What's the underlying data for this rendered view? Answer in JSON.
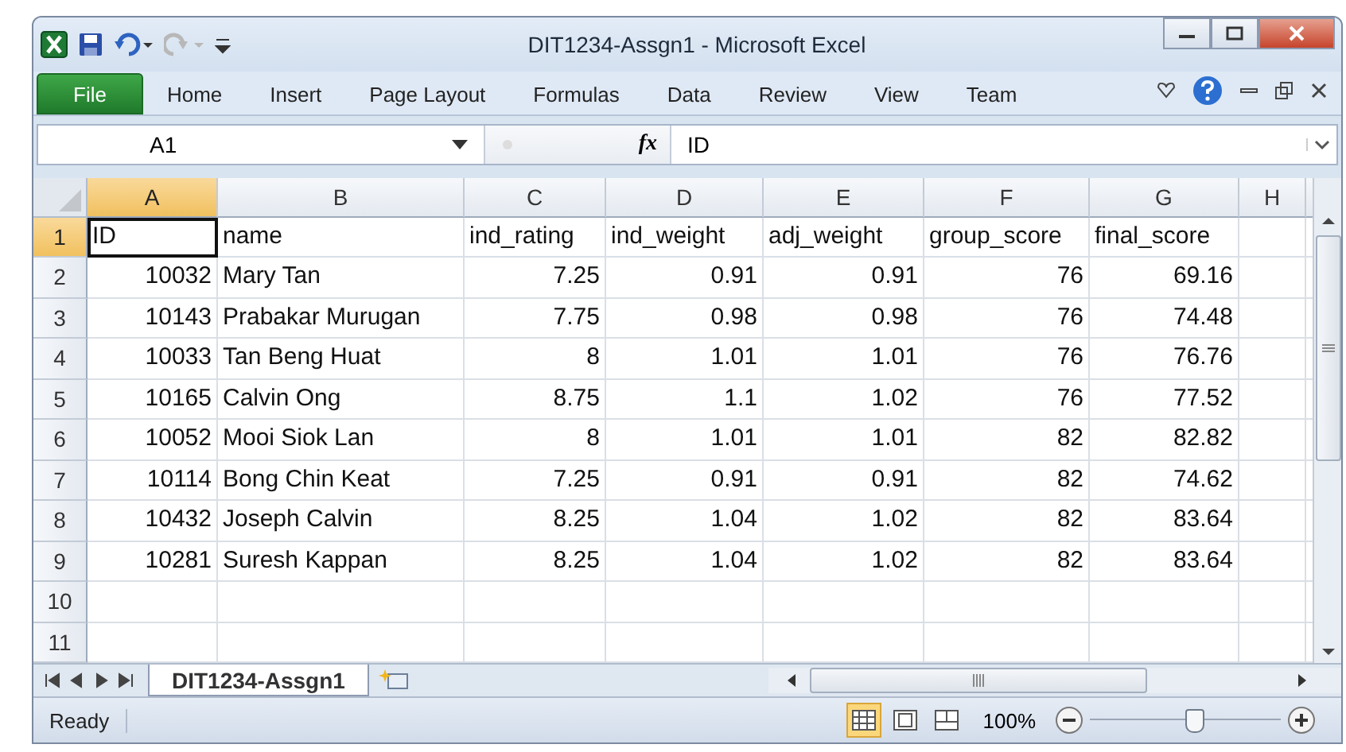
{
  "window": {
    "title": "DIT1234-Assgn1  -  Microsoft Excel"
  },
  "ribbon_tabs": [
    {
      "label": "File",
      "kind": "file",
      "selected": false
    },
    {
      "label": "Home",
      "kind": "tab",
      "selected": false
    },
    {
      "label": "Insert",
      "kind": "tab",
      "selected": false
    },
    {
      "label": "Page Layout",
      "kind": "tab",
      "selected": false
    },
    {
      "label": "Formulas",
      "kind": "tab",
      "selected": false
    },
    {
      "label": "Data",
      "kind": "tab",
      "selected": false
    },
    {
      "label": "Review",
      "kind": "tab",
      "selected": false
    },
    {
      "label": "View",
      "kind": "tab",
      "selected": false
    },
    {
      "label": "Team",
      "kind": "tab",
      "selected": false
    }
  ],
  "formula_bar": {
    "name_box": "A1",
    "fx": "fx",
    "value": "ID"
  },
  "columns": [
    {
      "label": "A",
      "kind": "number",
      "selected": true
    },
    {
      "label": "B",
      "kind": "text",
      "selected": false
    },
    {
      "label": "C",
      "kind": "number",
      "selected": false
    },
    {
      "label": "D",
      "kind": "number",
      "selected": false
    },
    {
      "label": "E",
      "kind": "number",
      "selected": false
    },
    {
      "label": "F",
      "kind": "number",
      "selected": false
    },
    {
      "label": "G",
      "kind": "number",
      "selected": false
    },
    {
      "label": "H",
      "kind": "text",
      "selected": false
    }
  ],
  "rows": [
    {
      "number": "1",
      "kind": "header",
      "selected": true,
      "cells": [
        "ID",
        "name",
        "ind_rating",
        "ind_weight",
        "adj_weight",
        "group_score",
        "final_score"
      ]
    },
    {
      "number": "2",
      "kind": "data",
      "selected": false,
      "cells": [
        "10032",
        "Mary Tan",
        "7.25",
        "0.91",
        "0.91",
        "76",
        "69.16"
      ]
    },
    {
      "number": "3",
      "kind": "data",
      "selected": false,
      "cells": [
        "10143",
        "Prabakar Murugan",
        "7.75",
        "0.98",
        "0.98",
        "76",
        "74.48"
      ]
    },
    {
      "number": "4",
      "kind": "data",
      "selected": false,
      "cells": [
        "10033",
        "Tan Beng Huat",
        "8",
        "1.01",
        "1.01",
        "76",
        "76.76"
      ]
    },
    {
      "number": "5",
      "kind": "data",
      "selected": false,
      "cells": [
        "10165",
        "Calvin Ong",
        "8.75",
        "1.1",
        "1.02",
        "76",
        "77.52"
      ]
    },
    {
      "number": "6",
      "kind": "data",
      "selected": false,
      "cells": [
        "10052",
        "Mooi Siok Lan",
        "8",
        "1.01",
        "1.01",
        "82",
        "82.82"
      ]
    },
    {
      "number": "7",
      "kind": "data",
      "selected": false,
      "cells": [
        "10114",
        "Bong Chin Keat",
        "7.25",
        "0.91",
        "0.91",
        "82",
        "74.62"
      ]
    },
    {
      "number": "8",
      "kind": "data",
      "selected": false,
      "cells": [
        "10432",
        "Joseph Calvin",
        "8.25",
        "1.04",
        "1.02",
        "82",
        "83.64"
      ]
    },
    {
      "number": "9",
      "kind": "data",
      "selected": false,
      "cells": [
        "10281",
        "Suresh Kappan",
        "8.25",
        "1.04",
        "1.02",
        "82",
        "83.64"
      ]
    },
    {
      "number": "10",
      "kind": "data",
      "selected": false,
      "cells": []
    },
    {
      "number": "11",
      "kind": "data",
      "selected": false,
      "cells": []
    }
  ],
  "sheet_tabs": [
    {
      "label": "DIT1234-Assgn1",
      "selected": true
    }
  ],
  "status_bar": {
    "status": "Ready",
    "views": [
      {
        "kind": "normal",
        "selected": true
      },
      {
        "kind": "page-layout",
        "selected": false
      },
      {
        "kind": "page-break",
        "selected": false
      }
    ],
    "zoom": "100%",
    "zoom_slider": {
      "level": 0.55
    }
  }
}
